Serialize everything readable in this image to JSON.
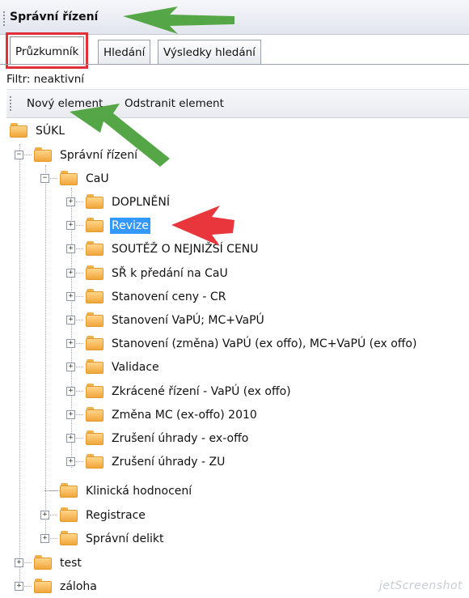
{
  "header": {
    "title": "Správní řízení"
  },
  "tabs": [
    {
      "label": "Průzkumník",
      "active": true
    },
    {
      "label": "Hledání",
      "active": false
    },
    {
      "label": "Výsledky hledání",
      "active": false
    }
  ],
  "filter_text": "Filtr: neaktivní",
  "toolbar": {
    "new_label": "Nový element",
    "remove_label": "Odstranit element"
  },
  "tree": {
    "root": "SÚKL",
    "spravni_rizeni": "Správní řízení",
    "cau": "CaU",
    "cau_children": [
      "DOPLNĚNÍ",
      "Revize",
      "SOUTĚŽ O NEJNIŽŠÍ CENU",
      "SŘ k předání na CaU",
      "Stanovení ceny - CR",
      "Stanovení VaPÚ; MC+VaPÚ",
      "Stanovení (změna) VaPÚ (ex offo), MC+VaPÚ (ex offo)",
      "Validace",
      "Zkrácené řízení - VaPÚ (ex offo)",
      "Změna MC (ex-offo) 2010",
      "Zrušení úhrady - ex-offo",
      "Zrušení úhrady - ZU"
    ],
    "selected": "Revize",
    "klinicka": "Klinická hodnocení",
    "registrace": "Registrace",
    "spravni_delikt": "Správní delikt",
    "test": "test",
    "zaloha": "záloha"
  },
  "watermark": "jetScreenshot"
}
